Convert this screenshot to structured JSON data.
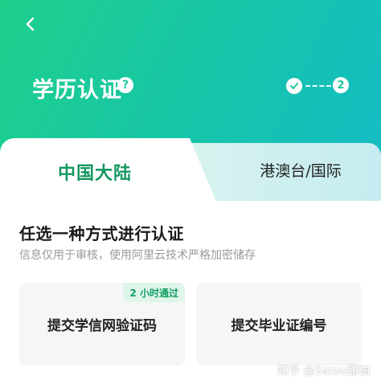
{
  "header": {
    "title": "学历认证",
    "help_icon": "question-circle-icon",
    "steps": {
      "current": "2"
    }
  },
  "tabs": [
    {
      "label": "中国大陆",
      "active": true
    },
    {
      "label": "港澳台/国际",
      "active": false
    }
  ],
  "section": {
    "title": "任选一种方式进行认证",
    "subtitle": "信息仅用于审核，使用阿里云技术严格加密储存"
  },
  "options": [
    {
      "label": "提交学信网验证码",
      "badge": "2 小时通过"
    },
    {
      "label": "提交毕业证编号"
    }
  ],
  "watermark": "知乎 @Satou甜柚",
  "colors": {
    "accent": "#14975f",
    "gradient_start": "#1fd08c",
    "gradient_end": "#13bcc6"
  }
}
